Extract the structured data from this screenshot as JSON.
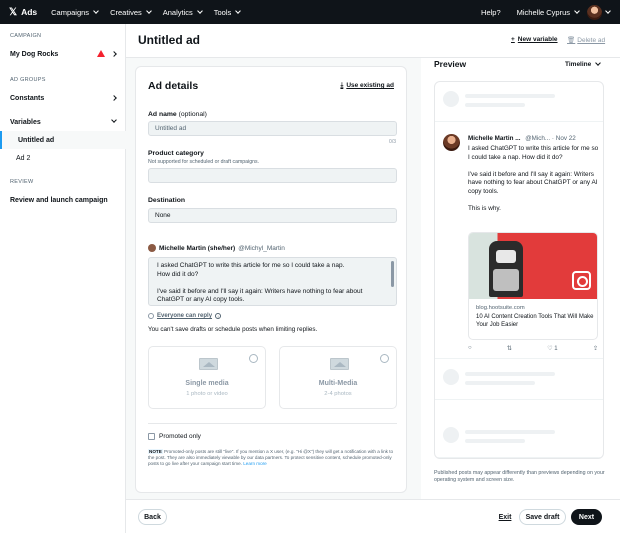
{
  "topbar": {
    "brand": "Ads",
    "nav": [
      "Campaigns",
      "Creatives",
      "Analytics",
      "Tools"
    ],
    "help": "Help?",
    "user": "Michelle Cyprus"
  },
  "sidebar": {
    "campaign_label": "CAMPAIGN",
    "campaign_name": "My Dog Rocks",
    "ad_groups_label": "AD GROUPS",
    "constants": "Constants",
    "variables": "Variables",
    "variable_items": [
      "Untitled ad",
      "Ad 2"
    ],
    "review_label": "REVIEW",
    "review_item": "Review and launch campaign"
  },
  "header": {
    "title": "Untitled ad",
    "new_variable": "New variable",
    "delete_ad": "Delete ad"
  },
  "details": {
    "title": "Ad details",
    "use_existing": "Use existing ad",
    "ad_name_label": "Ad name",
    "ad_name_optional": "(optional)",
    "ad_name_placeholder": "Untitled ad",
    "ad_name_counter": "0/3",
    "product_label": "Product category",
    "product_hint": "Not supported for scheduled or draft campaigns.",
    "destination_label": "Destination",
    "destination_value": "None",
    "author_name": "Michelle Martin (she/her)",
    "author_handle": "@Michyl_Martin",
    "tweet_lines": [
      "I asked ChatGPT to write this article for me so I could take a nap.",
      "How did it do?",
      "",
      "I've said it before and I'll say it again: Writers have nothing to fear about",
      "ChatGPT or any AI copy tools."
    ],
    "reply_label": "Everyone can reply",
    "no_save": "You can't save drafts or schedule posts when limiting replies.",
    "single_media_title": "Single media",
    "single_media_sub": "1 photo or video",
    "multi_media_title": "Multi-Media",
    "multi_media_sub": "2-4 photos",
    "promoted_only": "Promoted only",
    "note_tag": "NOTE",
    "note_text": "Promoted-only posts are still \"live\". If you mention a X user, (e.g. \"Hi @X\") they will get a notification with a link to the post. They are also immediately viewable by our data partners. To protect sensitive content, schedule promoted-only posts to go live after your campaign start time.",
    "learn_more": "Learn more"
  },
  "footer": {
    "back": "Back",
    "exit": "Exit",
    "save_draft": "Save draft",
    "next": "Next"
  },
  "preview": {
    "title": "Preview",
    "mode": "Timeline",
    "post_name": "Michelle Martin ...",
    "post_handle": "@Mich...",
    "post_date": "· Nov 22",
    "post_paragraphs": [
      "I asked ChatGPT to write this article for me so I could take a nap. How did it do?",
      "I've said it before and I'll say it again: Writers have nothing to fear about ChatGPT or any AI copy tools.",
      "This is why."
    ],
    "card_domain": "blog.hootsuite.com",
    "card_title": "10 AI Content Creation Tools That Will Make Your Job Easier",
    "like_count": "1",
    "caption": "Published posts may appear differently than previews depending on your operating system and screen size."
  },
  "colors": {
    "accent": "#1d9bf0",
    "topbar": "#0f1419",
    "warning": "#f4212e"
  }
}
